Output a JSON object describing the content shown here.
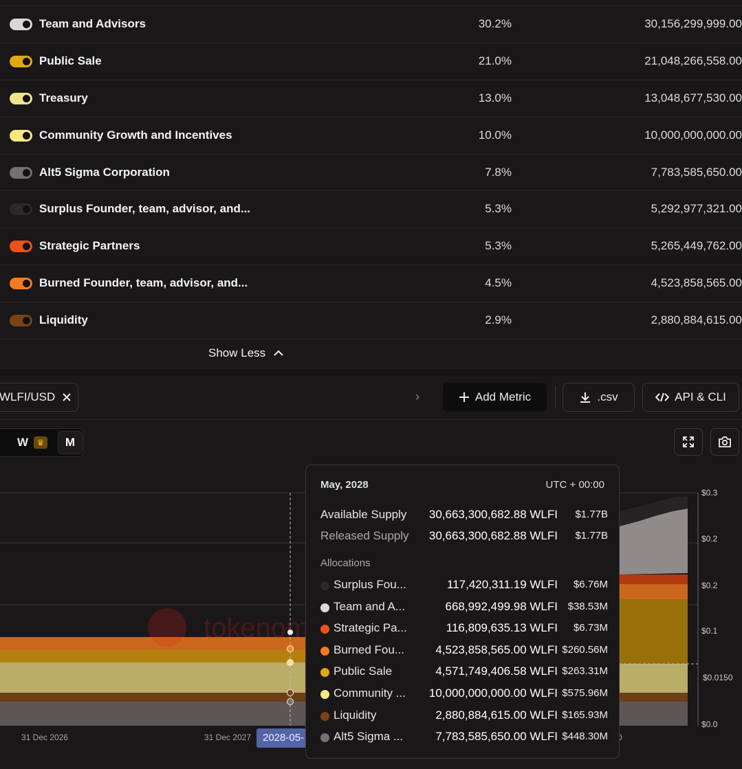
{
  "allocations": [
    {
      "name": "Team and Advisors",
      "pct": "30.2%",
      "amount": "30,156,299,999.00",
      "color": "#d8d6d6"
    },
    {
      "name": "Public Sale",
      "pct": "21.0%",
      "amount": "21,048,266,558.00",
      "color": "#e2a714"
    },
    {
      "name": "Treasury",
      "pct": "13.0%",
      "amount": "13,048,677,530.00",
      "color": "#f3e38f"
    },
    {
      "name": "Community Growth and Incentives",
      "pct": "10.0%",
      "amount": "10,000,000,000.00",
      "color": "#f6e880"
    },
    {
      "name": "Alt5 Sigma Corporation",
      "pct": "7.8%",
      "amount": "7,783,585,650.00",
      "color": "#75706c"
    },
    {
      "name": "Surplus Founder, team, advisor, and...",
      "pct": "5.3%",
      "amount": "5,292,977,321.00",
      "color": "#2a2828"
    },
    {
      "name": "Strategic Partners",
      "pct": "5.3%",
      "amount": "5,265,449,762.00",
      "color": "#f0511a"
    },
    {
      "name": "Burned Founder, team, advisor, and...",
      "pct": "4.5%",
      "amount": "4,523,858,565.00",
      "color": "#f57a22"
    },
    {
      "name": "Liquidity",
      "pct": "2.9%",
      "amount": "2,880,884,615.00",
      "color": "#7a4316"
    }
  ],
  "show_less_label": "Show Less",
  "toolbar": {
    "pair_label": "WLFI/USD",
    "add_metric_label": "Add Metric",
    "csv_label": ".csv",
    "api_label": "API & CLI"
  },
  "granularity": {
    "w_label": "W",
    "m_label": "M",
    "selected": "M"
  },
  "chart": {
    "watermark": "tokenomist",
    "x_ticks": [
      "31 Dec 2026",
      "31 Dec 2027"
    ],
    "x_crosshair_label": "2028-05-",
    "x_partial_label": "0",
    "y_ticks": [
      "$0.3",
      "$0.2",
      "$0.2",
      "$0.1",
      "$0.0"
    ],
    "y_crosshair_label": "$0.0150"
  },
  "tooltip": {
    "title": "May, 2028",
    "timezone": "UTC + 00:00",
    "available": {
      "label": "Available Supply",
      "value": "30,663,300,682.88 WLFI",
      "usd": "$1.77B"
    },
    "released": {
      "label": "Released Supply",
      "value": "30,663,300,682.88 WLFI",
      "usd": "$1.77B"
    },
    "section_label": "Allocations",
    "allocations": [
      {
        "label": "Surplus Fou...",
        "value": "117,420,311.19 WLFI",
        "usd": "$6.76M",
        "color": "#2a2828"
      },
      {
        "label": "Team and A...",
        "value": "668,992,499.98 WLFI",
        "usd": "$38.53M",
        "color": "#dcdada"
      },
      {
        "label": "Strategic Pa...",
        "value": "116,809,635.13 WLFI",
        "usd": "$6.73M",
        "color": "#f0511a"
      },
      {
        "label": "Burned Fou...",
        "value": "4,523,858,565.00 WLFI",
        "usd": "$260.56M",
        "color": "#f57a22"
      },
      {
        "label": "Public Sale",
        "value": "4,571,749,406.58 WLFI",
        "usd": "$263.31M",
        "color": "#e2a714"
      },
      {
        "label": "Community ...",
        "value": "10,000,000,000.00 WLFI",
        "usd": "$575.96M",
        "color": "#f6e880"
      },
      {
        "label": "Liquidity",
        "value": "2,880,884,615.00 WLFI",
        "usd": "$165.93M",
        "color": "#7a4316"
      },
      {
        "label": "Alt5 Sigma ...",
        "value": "7,783,585,650.00 WLFI",
        "usd": "$448.30M",
        "color": "#75706c"
      }
    ]
  }
}
